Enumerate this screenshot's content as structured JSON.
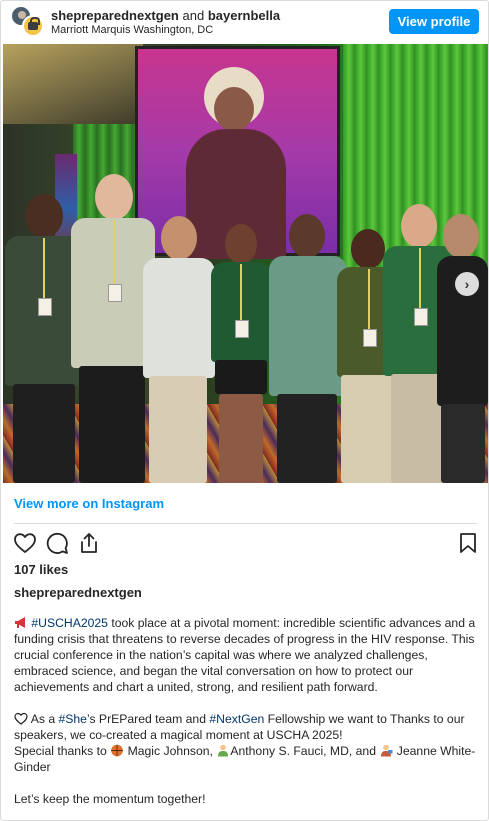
{
  "header": {
    "user_primary": "shepreparednextgen",
    "conjunction": "and",
    "user_secondary": "bayernbella",
    "location": "Marriott Marquis Washington, DC",
    "view_profile_label": "View profile"
  },
  "photo": {
    "next_icon": "chevron-right-icon"
  },
  "view_more_label": "View more on Instagram",
  "actions": {
    "like_icon": "heart-icon",
    "comment_icon": "comment-icon",
    "share_icon": "share-icon",
    "save_icon": "bookmark-icon"
  },
  "likes_label": "107 likes",
  "caption": {
    "username": "shepreparednextgen",
    "p1_tag": "#USCHA2025",
    "p1_text": " took place at a pivotal moment: incredible scientific advances and a funding crisis that threatens to reverse decades of progress in the HIV response. This crucial conference in the nation’s capital was where we analyzed challenges, embraced science, and began the vital conversation on how to protect our achievements and chart a united, strong, and resilient path forward.",
    "p2_pre": " As a ",
    "p2_tag1": "#She",
    "p2_mid1": "’s PrEPared team and ",
    "p2_tag2": "#NextGen",
    "p2_mid2": " Fellowship we want to Thanks to our speakers, we co-created a magical moment at USCHA 2025!",
    "p2_thanks": "Special thanks to ",
    "p2_name1": " Magic Johnson, ",
    "p2_name2": "Anthony S. Fauci, MD, and ",
    "p2_name3": " Jeanne White-Ginder",
    "p3_text": "Let’s keep the momentum together!"
  },
  "colors": {
    "accent": "#0095f6",
    "hashtag": "#00376b",
    "text": "#262626",
    "divider": "#dbdbdb"
  }
}
